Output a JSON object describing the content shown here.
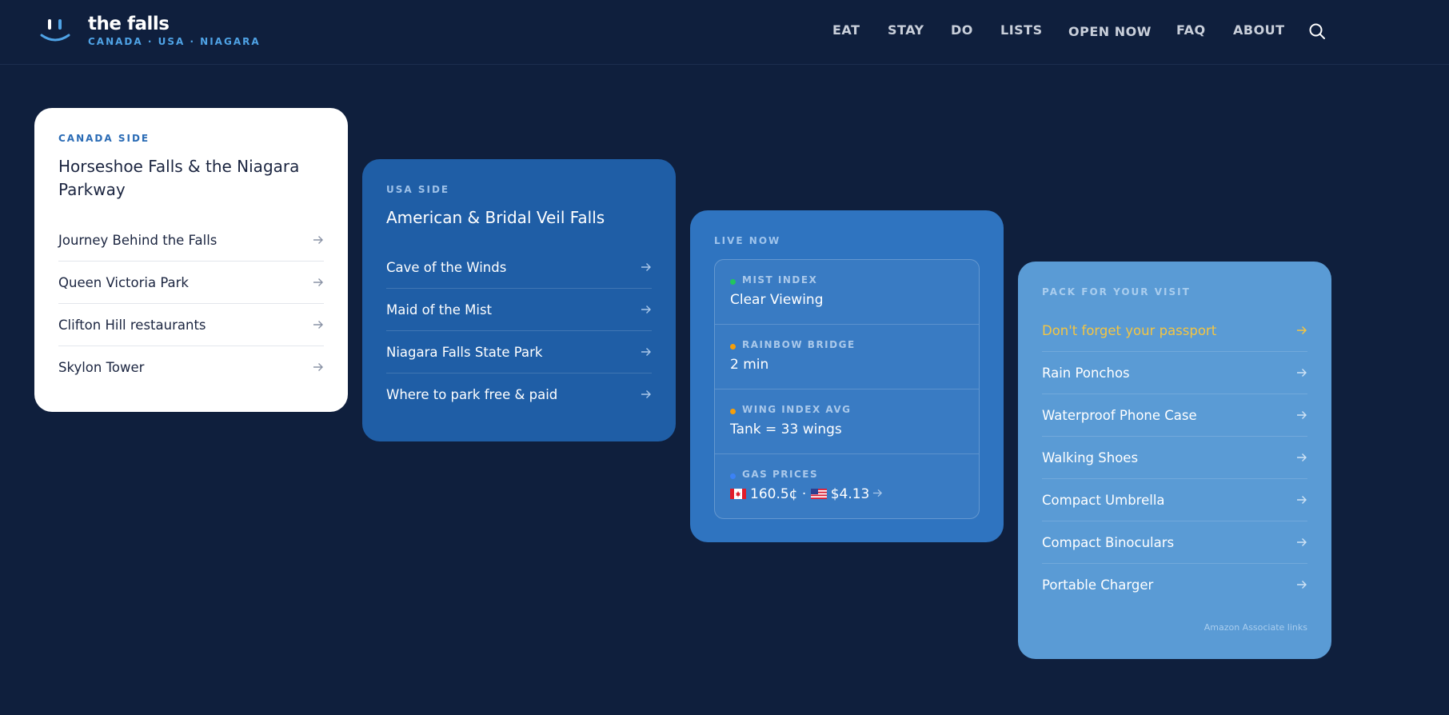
{
  "brand": {
    "name": "the falls",
    "tagline": "CANADA · USA · NIAGARA"
  },
  "nav": {
    "items": [
      {
        "label": "EAT"
      },
      {
        "label": "STAY"
      },
      {
        "label": "DO"
      },
      {
        "label": "LISTS"
      },
      {
        "label": "OPEN NOW"
      },
      {
        "label": "FAQ"
      },
      {
        "label": "ABOUT"
      }
    ],
    "search_icon": "search-icon"
  },
  "canada": {
    "eyebrow": "CANADA SIDE",
    "title": "Horseshoe Falls & the Niagara Parkway",
    "links": [
      {
        "label": "Journey Behind the Falls"
      },
      {
        "label": "Queen Victoria Park"
      },
      {
        "label": "Clifton Hill restaurants"
      },
      {
        "label": "Skylon Tower"
      }
    ]
  },
  "usa": {
    "eyebrow": "USA SIDE",
    "title": "American & Bridal Veil Falls",
    "links": [
      {
        "label": "Cave of the Winds"
      },
      {
        "label": "Maid of the Mist"
      },
      {
        "label": "Niagara Falls State Park"
      },
      {
        "label": "Where to park free & paid"
      }
    ]
  },
  "live": {
    "eyebrow": "LIVE NOW",
    "rows": [
      {
        "label": "MIST INDEX",
        "value": "Clear Viewing",
        "dot_color": "#22c55e"
      },
      {
        "label": "RAINBOW BRIDGE",
        "value": "2 min",
        "dot_color": "#f59e0b"
      },
      {
        "label": "WING INDEX AVG",
        "value": "Tank = 33 wings",
        "dot_color": "#f59e0b"
      },
      {
        "label": "GAS PRICES",
        "value_ca": "160.5¢",
        "separator": "·",
        "value_us": "$4.13",
        "dot_color": "#3b82f6"
      }
    ]
  },
  "pack": {
    "eyebrow": "PACK FOR YOUR VISIT",
    "links": [
      {
        "label": "Don't forget your passport"
      },
      {
        "label": "Rain Ponchos"
      },
      {
        "label": "Waterproof Phone Case"
      },
      {
        "label": "Walking Shoes"
      },
      {
        "label": "Compact Umbrella"
      },
      {
        "label": "Compact Binoculars"
      },
      {
        "label": "Portable Charger"
      }
    ],
    "footnote": "Amazon Associate links"
  },
  "colors": {
    "background": "#0f1f3d",
    "brand_accent": "#4fa3e6",
    "highlight": "#f4c542"
  }
}
